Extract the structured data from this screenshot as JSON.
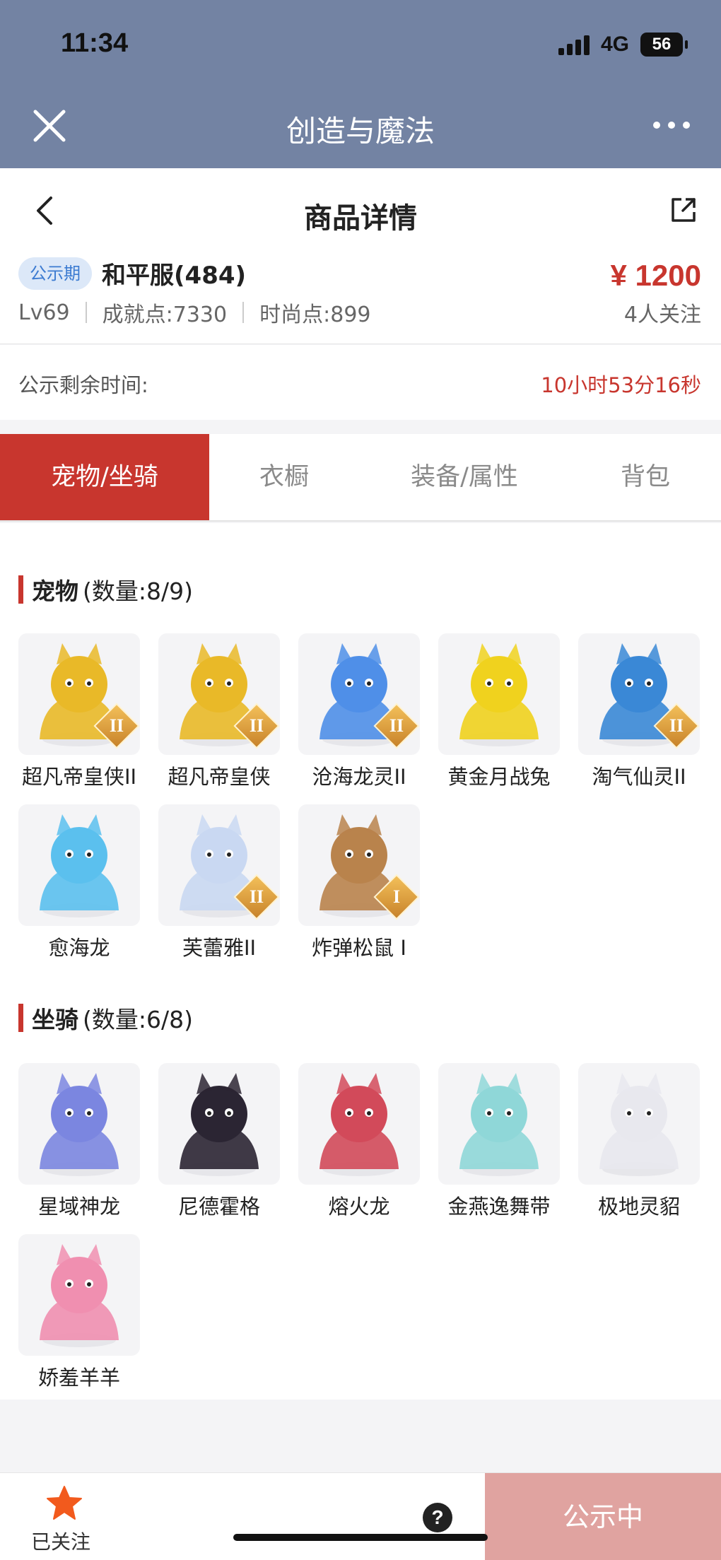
{
  "status_bar": {
    "time": "11:34",
    "network": "4G",
    "battery": "56"
  },
  "mini_program": {
    "title": "创造与魔法"
  },
  "page": {
    "title": "商品详情"
  },
  "info": {
    "badge": "公示期",
    "server": "和平服(484)",
    "price": "¥ 1200",
    "level": "Lv69",
    "achievement": "成就点:7330",
    "fashion": "时尚点:899",
    "followers": "4人关注"
  },
  "countdown": {
    "label": "公示剩余时间:",
    "value": "10小时53分16秒"
  },
  "tabs": [
    {
      "label": "宠物/坐骑",
      "active": true
    },
    {
      "label": "衣橱",
      "active": false
    },
    {
      "label": "装备/属性",
      "active": false
    },
    {
      "label": "背包",
      "active": false
    }
  ],
  "pets": {
    "title": "宠物",
    "count": "(数量:8/9)",
    "items": [
      {
        "name": "超凡帝皇侠II",
        "rank": "II",
        "color": "#e9b928",
        "icon": "golden-armor-icon"
      },
      {
        "name": "超凡帝皇侠",
        "rank": "II",
        "color": "#e9b928",
        "icon": "golden-armor-icon"
      },
      {
        "name": "沧海龙灵II",
        "rank": "II",
        "color": "#4f8fe8",
        "icon": "blue-dragon-spirit-icon"
      },
      {
        "name": "黄金月战兔",
        "rank": "",
        "color": "#f0d21e",
        "icon": "golden-rabbit-icon"
      },
      {
        "name": "淘气仙灵II",
        "rank": "II",
        "color": "#3a88d6",
        "icon": "blue-puppy-icon"
      },
      {
        "name": "愈海龙",
        "rank": "",
        "color": "#5bc0ee",
        "icon": "sea-dragon-icon"
      },
      {
        "name": "芙蕾雅II",
        "rank": "II",
        "color": "#c9d8f2",
        "icon": "freya-icon"
      },
      {
        "name": "炸弹松鼠 I",
        "rank": "I",
        "color": "#b9834c",
        "icon": "bomb-squirrel-icon"
      }
    ]
  },
  "mounts": {
    "title": "坐骑",
    "count": "(数量:6/8)",
    "items": [
      {
        "name": "星域神龙",
        "rank": "",
        "color": "#7b86e0",
        "icon": "star-dragon-icon"
      },
      {
        "name": "尼德霍格",
        "rank": "",
        "color": "#2b2533",
        "icon": "nidhogg-icon"
      },
      {
        "name": "熔火龙",
        "rank": "",
        "color": "#d24a5a",
        "icon": "fire-dragon-icon"
      },
      {
        "name": "金燕逸舞带",
        "rank": "",
        "color": "#8fd7d8",
        "icon": "ribbon-icon"
      },
      {
        "name": "极地灵貂",
        "rank": "",
        "color": "#e8e8ee",
        "icon": "polar-mink-icon"
      },
      {
        "name": "娇羞羊羊",
        "rank": "",
        "color": "#f08fb0",
        "icon": "shy-sheep-icon"
      }
    ]
  },
  "bottom": {
    "follow_label": "已关注",
    "help": "?",
    "status_label": "公示中"
  }
}
